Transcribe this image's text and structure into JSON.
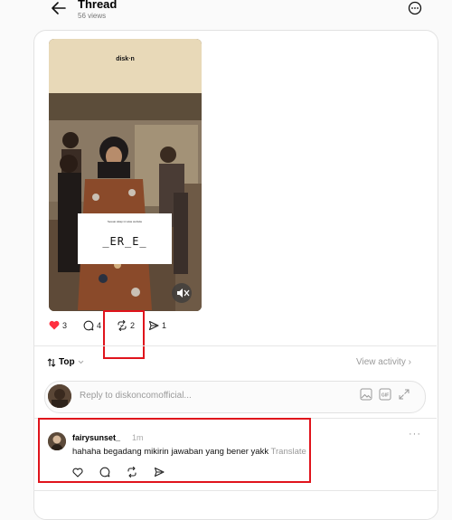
{
  "header": {
    "title": "Thread",
    "views": "56 views"
  },
  "post": {
    "video": {
      "watermark": "disk·n",
      "card_caption": "Sesuai sikap ini atas website",
      "card_puzzle": "_ER_E_"
    },
    "likes": "3",
    "replies": "4",
    "reposts": "2",
    "shares": "1"
  },
  "sort": {
    "label": "Top",
    "view_activity": "View activity"
  },
  "reply_box": {
    "placeholder": "Reply to diskoncomofficial..."
  },
  "comment": {
    "username": "fairysunset_",
    "time": "1m",
    "text": "hahaha begadang mikirin jawaban yang bener yakk",
    "translate": "Translate"
  },
  "colors": {
    "like_red": "#ff3040",
    "highlight_red": "#e0141c"
  }
}
